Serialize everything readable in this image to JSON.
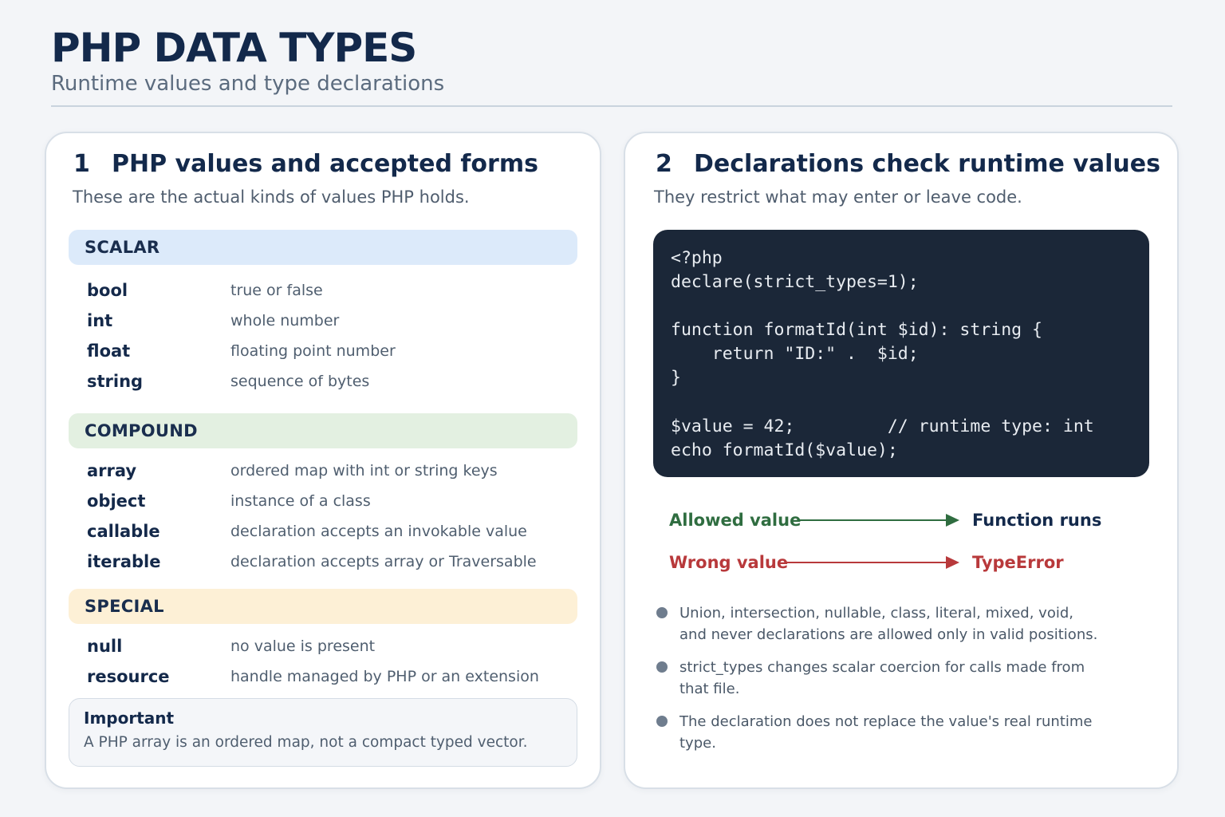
{
  "header": {
    "title": "PHP DATA TYPES",
    "subtitle": "Runtime values and type declarations"
  },
  "left_panel": {
    "number": "1",
    "title": "PHP values and accepted forms",
    "subtitle": "These are the actual kinds of values PHP holds.",
    "groups": [
      {
        "label": "SCALAR",
        "color": "#dceafa",
        "rows": [
          {
            "type": "bool",
            "description": "true or false"
          },
          {
            "type": "int",
            "description": "whole number"
          },
          {
            "type": "float",
            "description": "floating point number"
          },
          {
            "type": "string",
            "description": "sequence of bytes"
          }
        ]
      },
      {
        "label": "COMPOUND",
        "color": "#e3f0e1",
        "rows": [
          {
            "type": "array",
            "description": "ordered map with int or string keys"
          },
          {
            "type": "object",
            "description": "instance of a class"
          },
          {
            "type": "callable",
            "description": "declaration accepts an invokable value"
          },
          {
            "type": "iterable",
            "description": "declaration accepts array or Traversable"
          }
        ]
      },
      {
        "label": "SPECIAL",
        "color": "#fdf0d6",
        "rows": [
          {
            "type": "null",
            "description": "no value is present"
          },
          {
            "type": "resource",
            "description": "handle managed by PHP or an extension"
          }
        ]
      }
    ],
    "note": {
      "title": "Important",
      "text": "A PHP array is an ordered map, not a compact typed vector."
    }
  },
  "right_panel": {
    "number": "2",
    "title": "Declarations check runtime values",
    "subtitle": "They restrict what may enter or leave code.",
    "code_background": "#1b2738",
    "code_lines": [
      "<?php",
      "declare(strict_types=1);",
      "",
      "function formatId(int $id): string {",
      "    return \"ID:\" .  $id;",
      "}",
      "",
      "$value = 42;         // runtime type: int",
      "echo formatId($value);"
    ],
    "flows": [
      {
        "from": "Allowed value",
        "to": "Function runs",
        "color": "#2f6d40",
        "target_color": "#13294b"
      },
      {
        "from": "Wrong value",
        "to": "TypeError",
        "color": "#b8393b",
        "target_color": "#b8393b"
      }
    ],
    "notes": [
      {
        "lines": [
          "Union, intersection, nullable, class, literal, mixed, void,",
          "and never declarations are allowed only in valid positions."
        ]
      },
      {
        "lines": [
          "strict_types changes scalar coercion for calls made from",
          "that file."
        ]
      },
      {
        "lines": [
          "The declaration does not replace the value's real runtime",
          "type."
        ]
      }
    ]
  }
}
